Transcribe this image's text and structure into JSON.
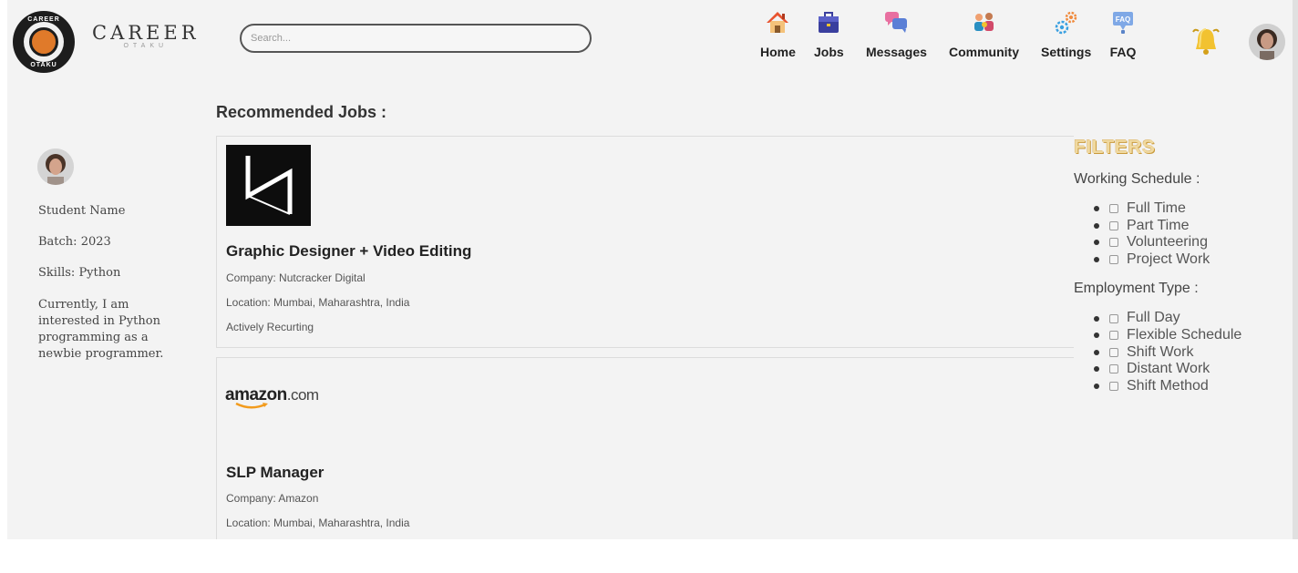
{
  "brand": {
    "name": "CAREER",
    "sub": "OTAKU",
    "logo_text_top": "CAREER",
    "logo_text_bottom": "OTAKU"
  },
  "search": {
    "placeholder": "Search..."
  },
  "nav": [
    {
      "label": "Home",
      "icon": "home-icon"
    },
    {
      "label": "Jobs",
      "icon": "briefcase-icon"
    },
    {
      "label": "Messages",
      "icon": "chat-bubbles-icon"
    },
    {
      "label": "Community",
      "icon": "people-icon"
    },
    {
      "label": "Settings",
      "icon": "gears-icon"
    },
    {
      "label": "FAQ",
      "icon": "faq-icon",
      "badge": "FAQ"
    }
  ],
  "notifications": {
    "icon": "bell-icon"
  },
  "profile": {
    "name": "Student Name",
    "batch": "Batch: 2023",
    "skills": "Skills: Python",
    "bio": "Currently, I am interested in Python programming as a newbie programmer."
  },
  "main": {
    "section_title": "Recommended Jobs :",
    "jobs": [
      {
        "title": "Graphic Designer + Video Editing",
        "company": "Company: Nutcracker Digital",
        "location": "Location: Mumbai, Maharashtra, India",
        "status": "Actively Recurting",
        "logo": "N"
      },
      {
        "title": "SLP Manager",
        "company": "Company: Amazon",
        "location": "Location: Mumbai, Maharashtra, India",
        "logo_text": "amazon",
        "logo_suffix": ".com"
      }
    ]
  },
  "filters": {
    "title": "FILTERS",
    "groups": [
      {
        "title": "Working Schedule :",
        "options": [
          "Full Time",
          "Part Time",
          "Volunteering",
          "Project Work"
        ]
      },
      {
        "title": "Employment Type :",
        "options": [
          "Full Day",
          "Flexible Schedule",
          "Shift Work",
          "Distant Work",
          "Shift Method"
        ]
      }
    ]
  },
  "colors": {
    "background": "#f3f3f3",
    "filters_accent": "#e8c26a",
    "home_roof": "#e8532f",
    "jobs_blue": "#3a3f9e",
    "messages_pink": "#e86fa0",
    "community_teal": "#2a8fc2",
    "settings_orange": "#f08a3c",
    "faq_blue": "#7fa8e6",
    "bell_yellow": "#f2c230",
    "amazon_orange": "#f29b1d"
  }
}
